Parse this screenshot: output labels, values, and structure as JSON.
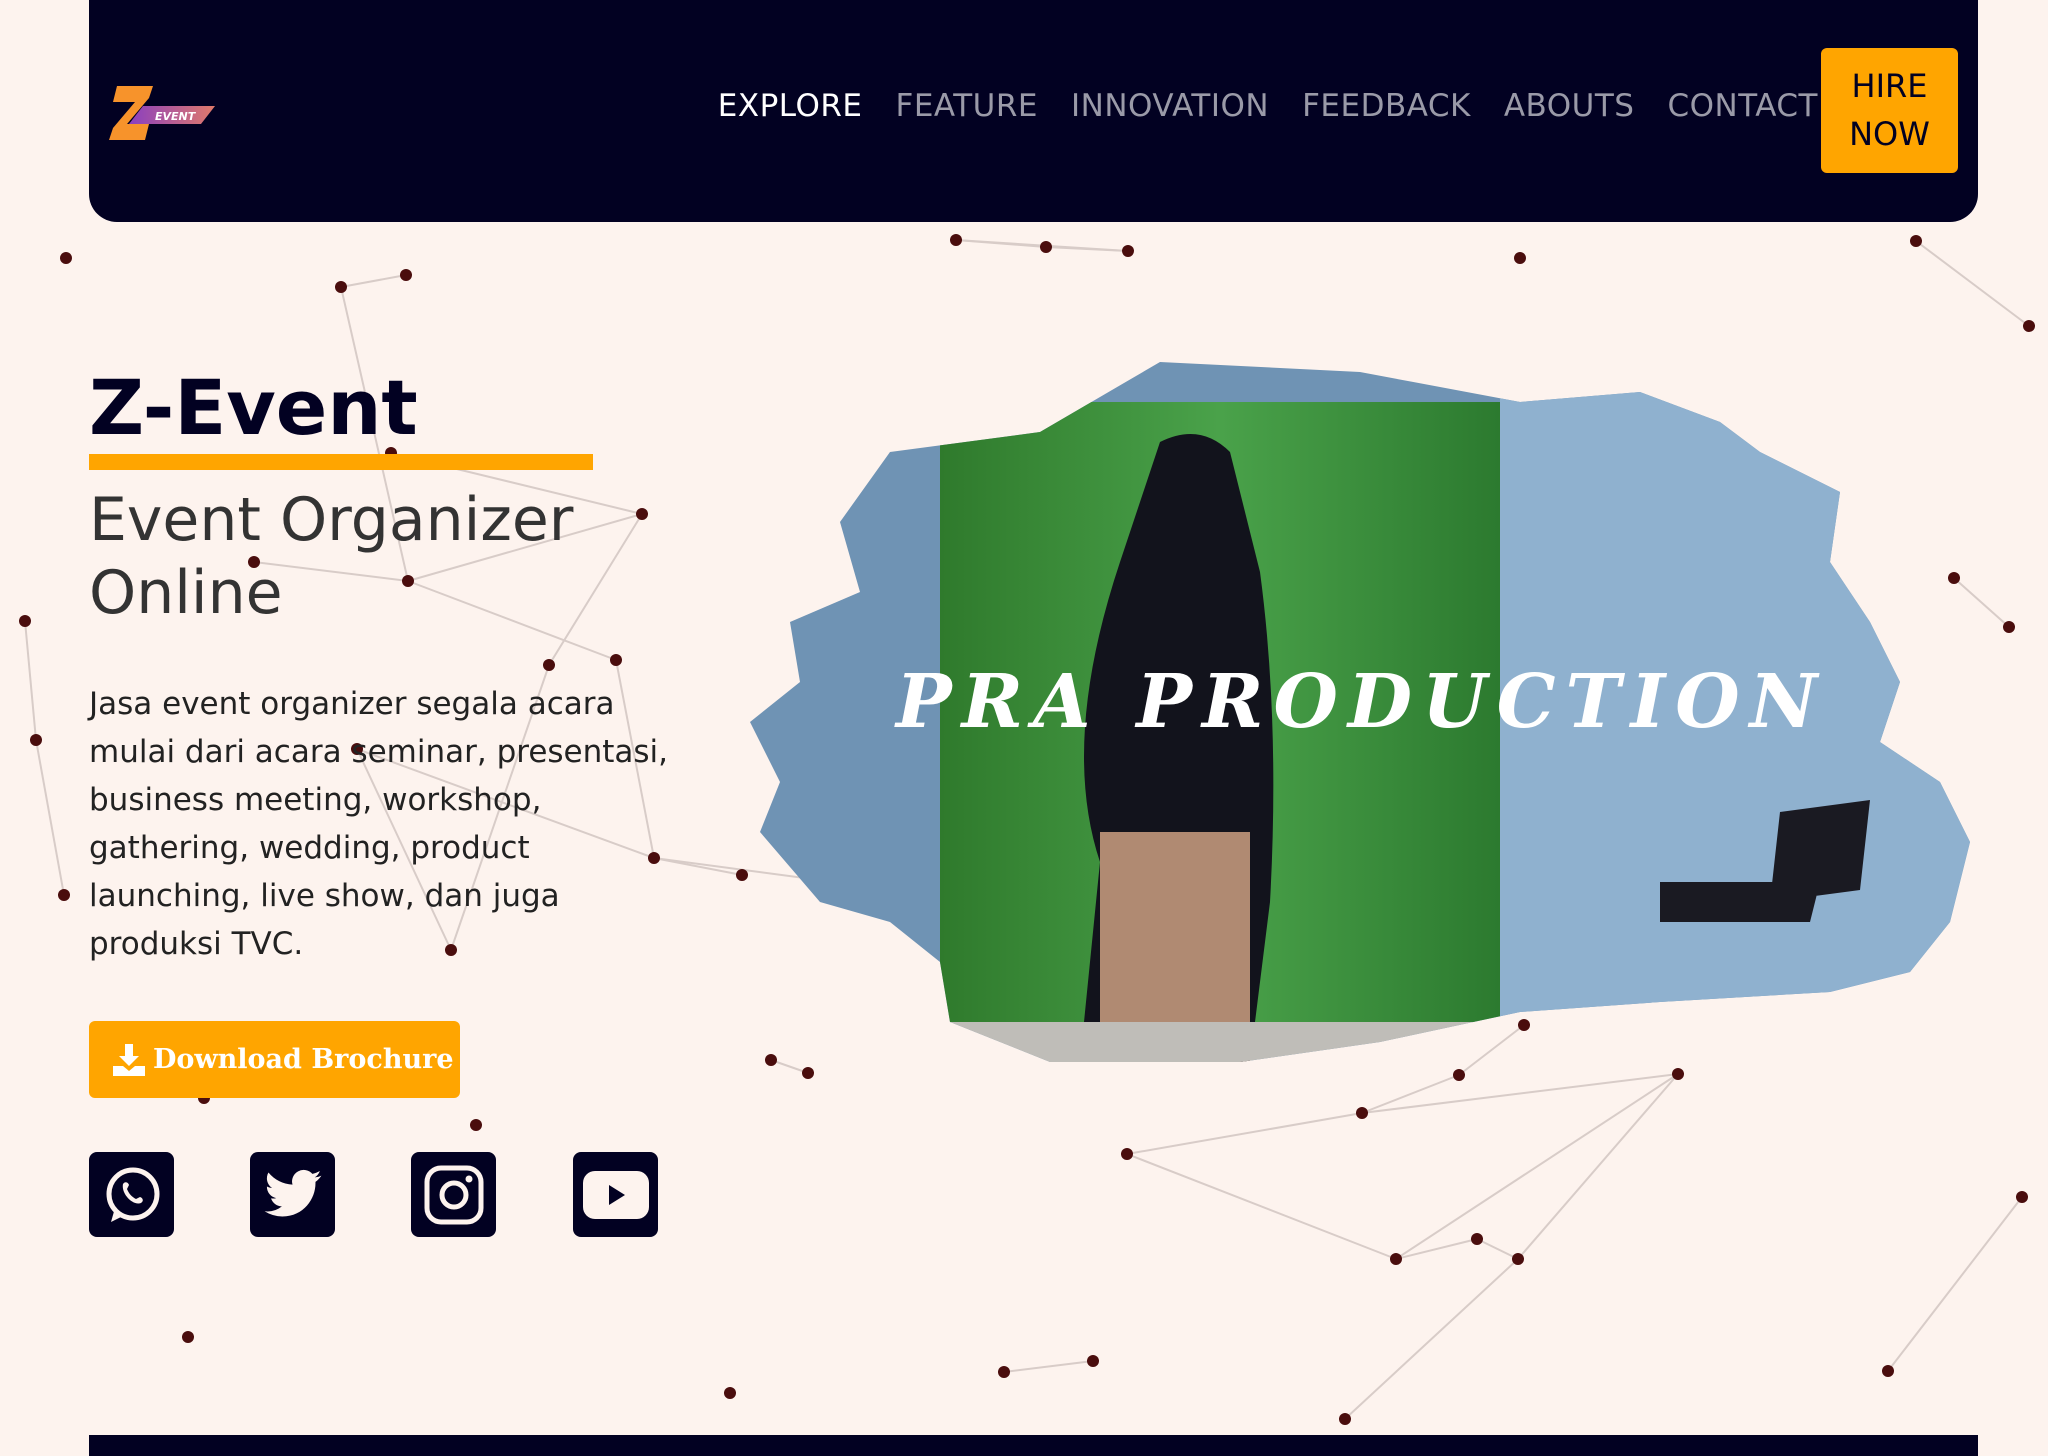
{
  "brand": {
    "logo_text": "Z EVENT"
  },
  "nav": {
    "items": [
      "EXPLORE",
      "FEATURE",
      "INNOVATION",
      "FEEDBACK",
      "ABOUTS",
      "CONTACT"
    ],
    "hire": [
      "HIRE",
      "NOW"
    ]
  },
  "hero": {
    "title": "Z-Event",
    "subtitle_1": "Event Organizer",
    "subtitle_2": "Online",
    "description": "Jasa event organizer segala acara mulai dari acara seminar, presentasi, business meeting, workshop, gathering, wedding, product launching, live show, dan juga produksi TVC.",
    "download": "Download Brochure"
  },
  "social": [
    "whatsapp-icon",
    "twitter-icon",
    "instagram-icon",
    "youtube-icon"
  ],
  "media": {
    "caption": "PRA PRODUCTION"
  },
  "colors": {
    "navy": "#020122",
    "accent": "#ffa500",
    "bg": "#fdf3ee"
  }
}
